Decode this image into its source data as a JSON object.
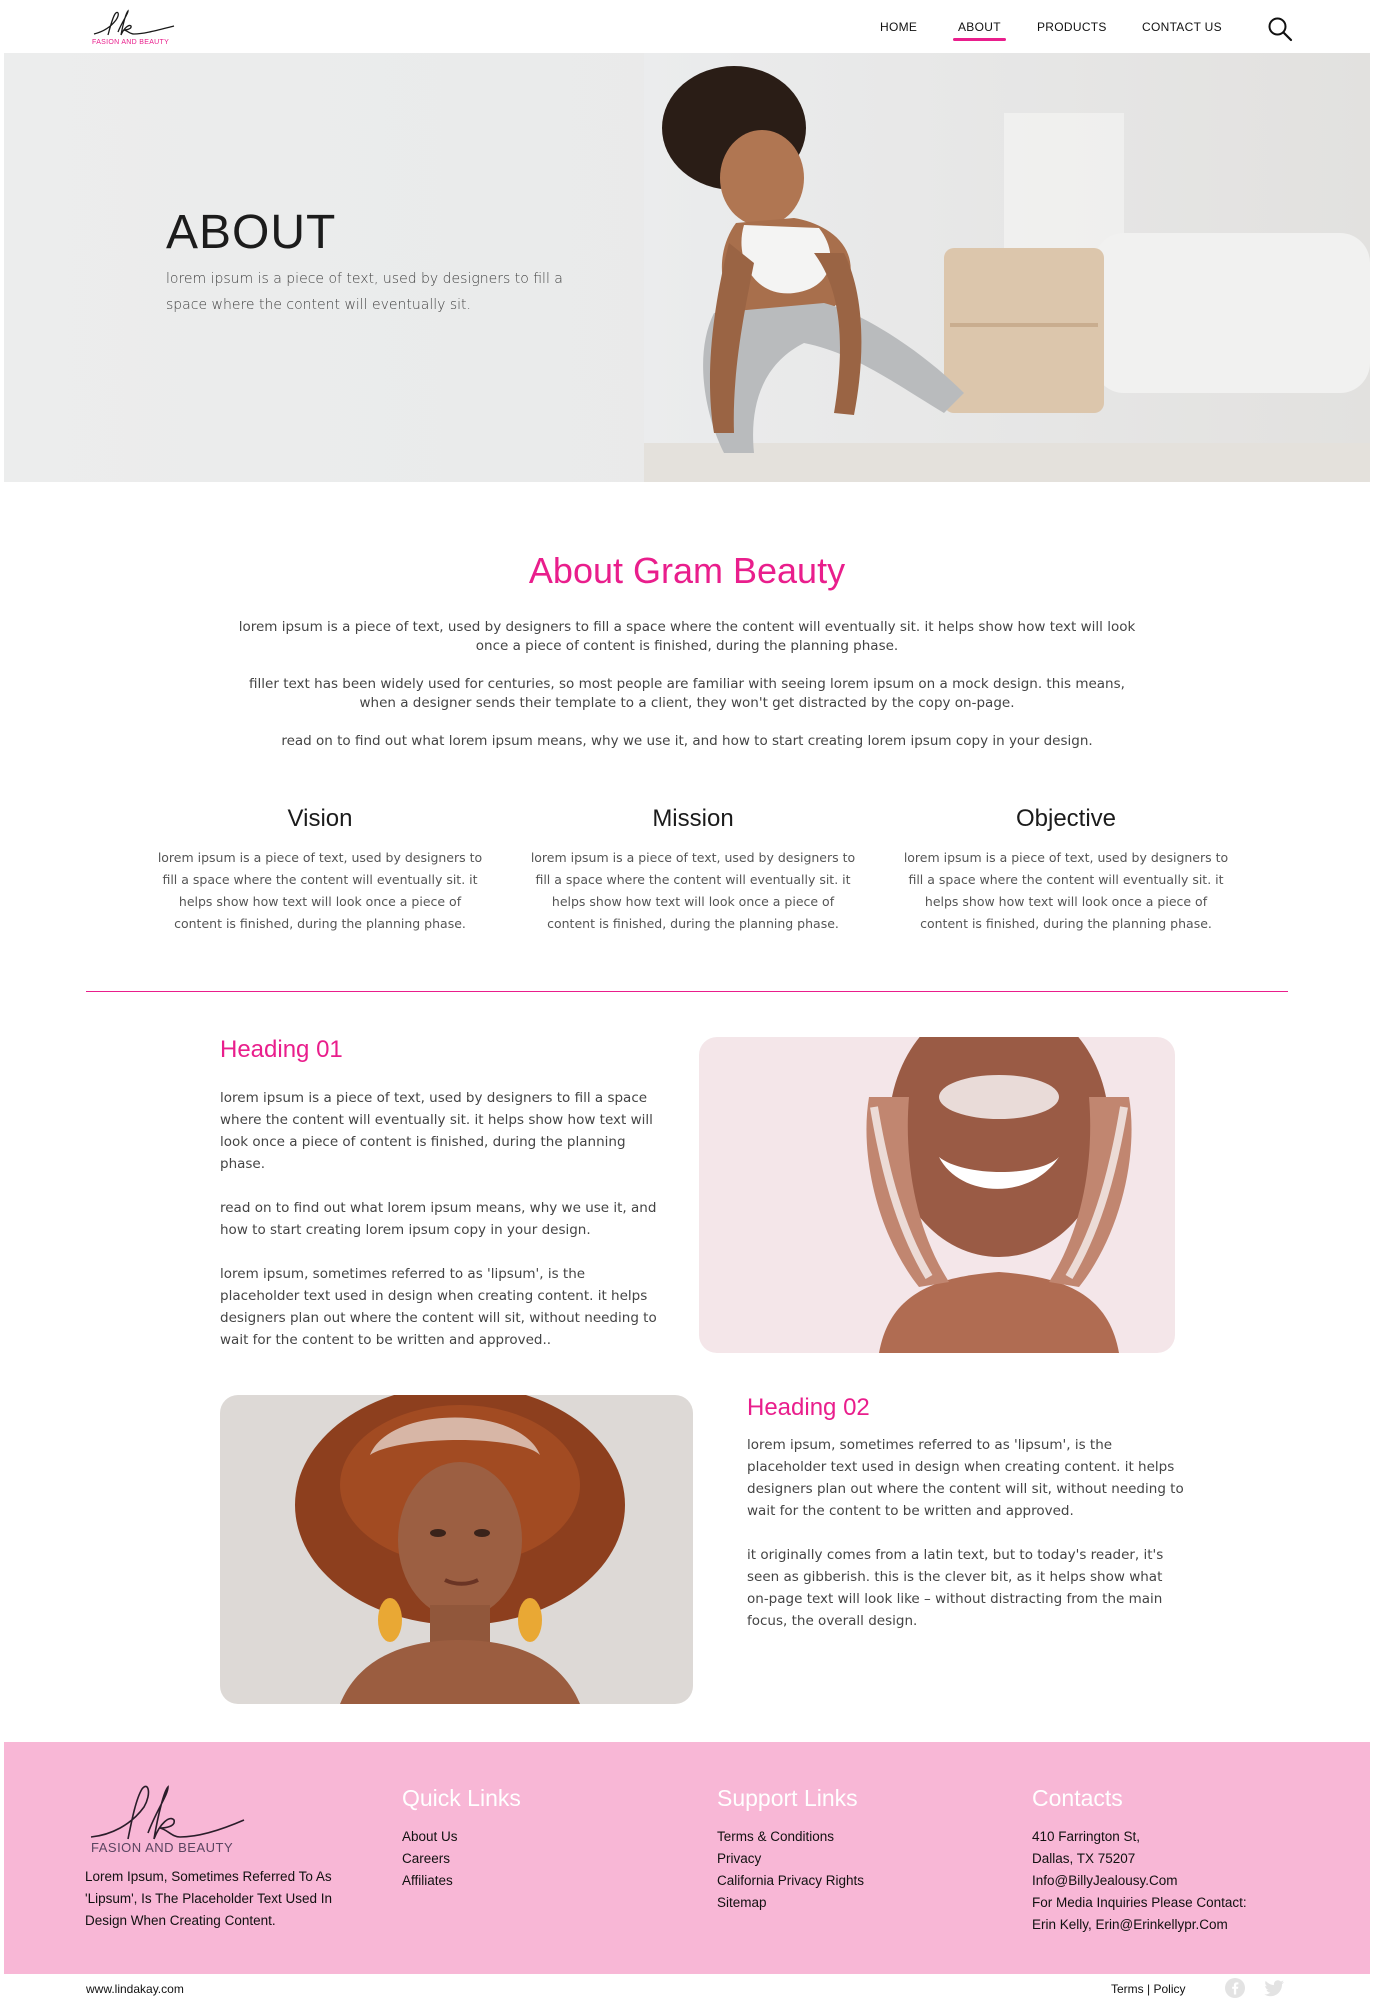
{
  "header": {
    "logo_text": "FASION AND BEAUTY",
    "nav": [
      {
        "label": "HOME",
        "active": false
      },
      {
        "label": "ABOUT",
        "active": true
      },
      {
        "label": "PRODUCTS",
        "active": false
      },
      {
        "label": "CONTACT US",
        "active": false
      }
    ],
    "search_icon": "search-icon"
  },
  "hero": {
    "title": "ABOUT",
    "text": "lorem ipsum is a piece of text, used by designers to fill a space where the content will eventually sit."
  },
  "about": {
    "title": "About Gram Beauty",
    "paragraphs": [
      "lorem ipsum is a piece of text, used by designers to fill a space where the content will eventually sit. it helps show how text will look once a piece of content is finished, during the planning phase.",
      "filler text has been widely used for centuries, so most people are familiar with seeing lorem ipsum on a mock design. this means, when a designer sends their template to a client, they won't get distracted by the copy on-page.",
      "read on to find out what lorem ipsum means, why we use it, and how to start creating lorem ipsum copy in your design."
    ],
    "columns": [
      {
        "title": "Vision",
        "text": "lorem ipsum is a piece of text, used by designers to fill a space where the content will eventually sit. it helps show how text will look once a piece of content is finished, during the planning phase."
      },
      {
        "title": "Mission",
        "text": "lorem ipsum is a piece of text, used by designers to fill a space where the content will eventually sit. it helps show how text will look once a piece of content is finished, during the planning phase."
      },
      {
        "title": "Objective",
        "text": "lorem ipsum is a piece of text, used by designers to fill a space where the content will eventually sit. it helps show how text will look once a piece of content is finished, during the planning phase."
      }
    ]
  },
  "section1": {
    "heading": "Heading 01",
    "paragraphs": [
      "lorem ipsum is a piece of text, used by designers to fill a space where the content will eventually sit. it helps show how text will look once a piece of content is finished, during the planning phase.",
      "read on to find out what lorem ipsum means, why we use it, and how to start creating lorem ipsum copy in your design.",
      "lorem ipsum, sometimes referred to as 'lipsum', is the placeholder text used in design when creating content. it helps designers plan out where the content will sit, without needing to wait for the content to be written and approved.."
    ]
  },
  "section2": {
    "heading": "Heading 02",
    "paragraphs": [
      "lorem ipsum, sometimes referred to as 'lipsum', is the placeholder text used in design when creating content. it helps designers plan out where the content will sit, without needing to wait for the content to be written and approved.",
      "it originally comes from a latin text, but to today's reader, it's seen as gibberish. this is the clever bit, as it helps show what on-page text will look like – without distracting from the main focus, the overall design."
    ]
  },
  "footer": {
    "logo_text": "FASION AND BEAUTY",
    "description": "Lorem Ipsum, Sometimes Referred To As 'Lipsum', Is The Placeholder Text Used In Design When Creating Content.",
    "quick_links": {
      "title": "Quick Links",
      "items": [
        "About Us",
        "Careers",
        "Affiliates"
      ]
    },
    "support_links": {
      "title": "Support Links",
      "items": [
        "Terms & Conditions",
        "Privacy",
        "California Privacy Rights",
        "Sitemap"
      ]
    },
    "contacts": {
      "title": "Contacts",
      "lines": [
        "410 Farrington St,",
        "Dallas, TX 75207",
        "Info@BillyJealousy.Com",
        "For Media Inquiries Please Contact:",
        "Erin Kelly,  Erin@Erinkellypr.Com"
      ]
    },
    "site_url": "www.lindakay.com",
    "terms": "Terms",
    "separator": "|",
    "policy": "Policy",
    "social_icons": [
      "facebook-icon",
      "twitter-icon"
    ]
  },
  "colors": {
    "accent": "#e91e8c",
    "footer_bg": "#f8b7d6"
  }
}
